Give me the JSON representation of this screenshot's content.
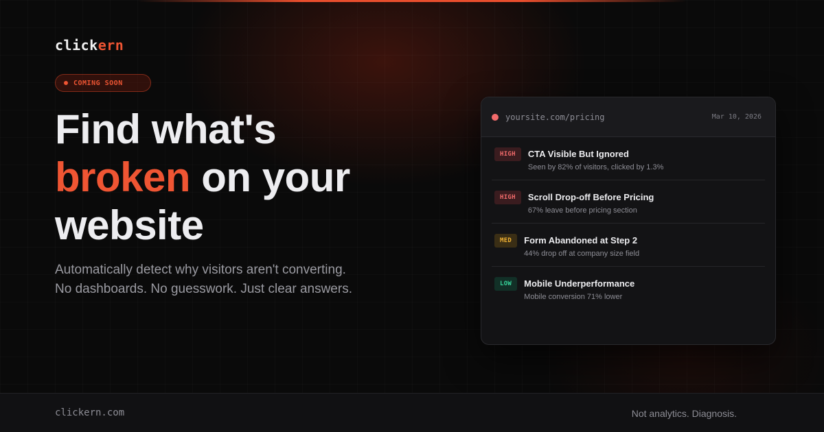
{
  "brand": {
    "logo_part1": "click",
    "logo_part2": "ern",
    "accent_color": "#ef5533"
  },
  "badge": {
    "label": "COMING SOON"
  },
  "hero": {
    "line1": "Find what's",
    "line2_accent": "broken",
    "line2_rest": " on your",
    "line3": "website",
    "subtitle_line1": "Automatically detect why visitors aren't converting.",
    "subtitle_line2": "No dashboards. No guesswork. Just clear answers."
  },
  "card": {
    "url": "yoursite.com/pricing",
    "date": "Mar 10, 2026",
    "issues": [
      {
        "severity": "HIGH",
        "title": "CTA Visible But Ignored",
        "detail": "Seen by 82% of visitors, clicked by 1.3%"
      },
      {
        "severity": "HIGH",
        "title": "Scroll Drop-off Before Pricing",
        "detail": "67% leave before pricing section"
      },
      {
        "severity": "MED",
        "title": "Form Abandoned at Step 2",
        "detail": "44% drop off at company size field"
      },
      {
        "severity": "LOW",
        "title": "Mobile Underperformance",
        "detail": "Mobile conversion 71% lower"
      }
    ]
  },
  "footer": {
    "domain": "clickern.com",
    "tagline": "Not analytics. Diagnosis."
  }
}
